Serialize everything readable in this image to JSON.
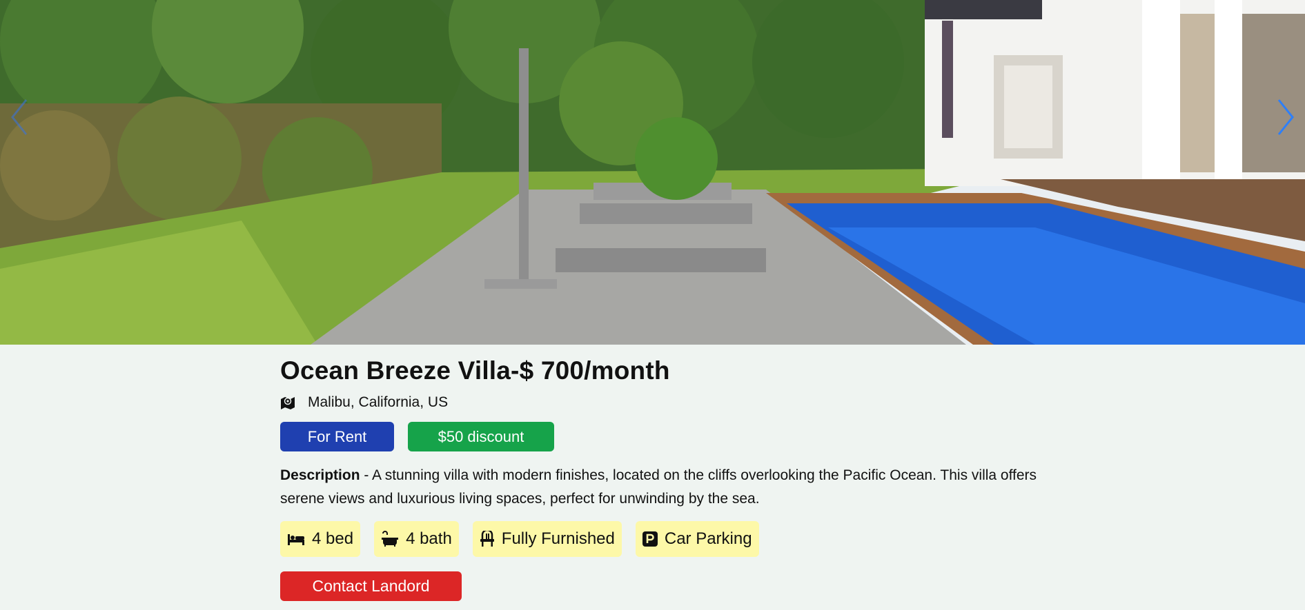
{
  "hero": {
    "prev_icon": "chevron-left-icon",
    "next_icon": "chevron-right-icon",
    "accent": "#2d7ff9"
  },
  "listing": {
    "title": "Ocean Breeze Villa-$ 700/month",
    "location": "Malibu, California, US",
    "location_icon": "map-pin-icon",
    "tags": {
      "rent": "For Rent",
      "discount": "$50 discount"
    },
    "description_label": "Description",
    "description_text": "- A stunning villa with modern finishes, located on the cliffs overlooking the Pacific Ocean. This villa offers serene views and luxurious living spaces, perfect for unwinding by the sea.",
    "features": {
      "bed": "4 bed",
      "bath": "4 bath",
      "furnished": "Fully Furnished",
      "parking": "Car Parking"
    },
    "contact_label": "Contact Landord"
  },
  "colors": {
    "background": "#eff4f1",
    "rent_tag": "#1f40b0",
    "discount_tag": "#16a34a",
    "feature_chip": "#fdf8a8",
    "contact_button": "#dc2626"
  }
}
